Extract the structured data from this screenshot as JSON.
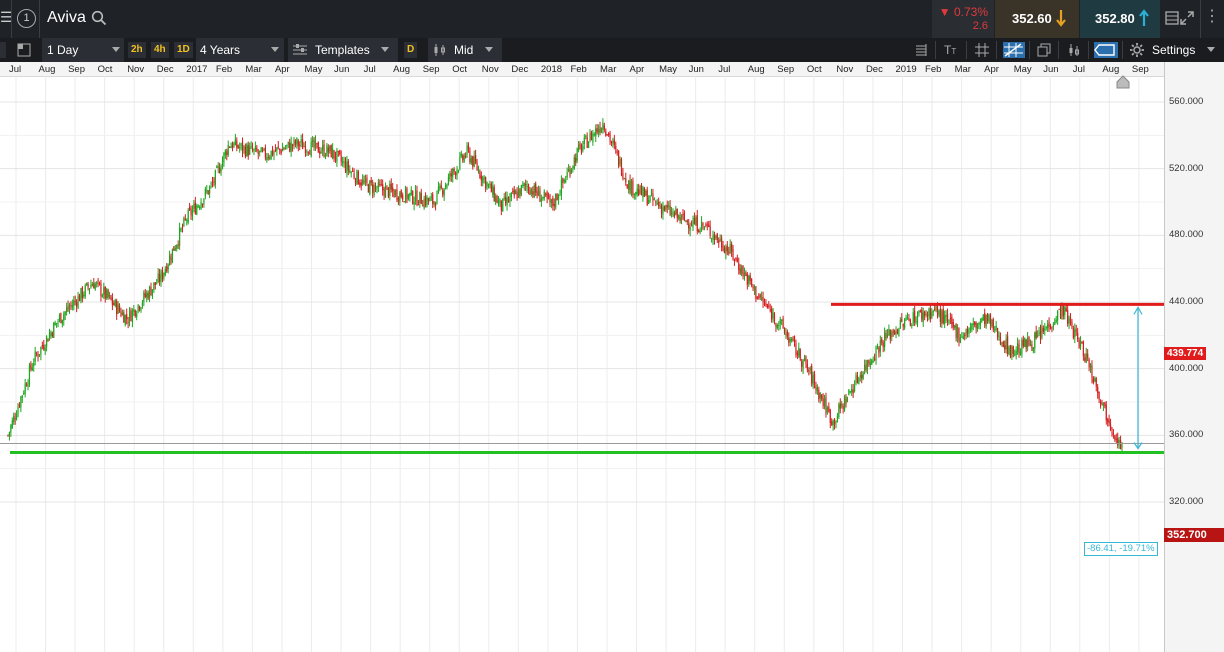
{
  "window": {
    "instrument": "Aviva",
    "info_label": "1"
  },
  "quote": {
    "change_pct": "▼ 0.73%",
    "change_abs": "2.6",
    "sell_price": "352.60",
    "buy_price": "352.80",
    "down_color": "#e03a3a",
    "up_color": "#29b0d8"
  },
  "toolbar": {
    "interval": "1 Day",
    "quick_2h": "2h",
    "quick_4h": "4h",
    "quick_1d": "1D",
    "range": "4 Years",
    "templates": "Templates",
    "d_badge": "D",
    "price_type": "Mid",
    "settings": "Settings",
    "icons": [
      "layout-icon",
      "text-size-icon",
      "grid-icon",
      "crosshair-icon",
      "copy-icon",
      "candle-type-icon",
      "price-tag-icon",
      "gear-icon"
    ]
  },
  "time_axis": [
    "Jul",
    "Aug",
    "Sep",
    "Oct",
    "Nov",
    "Dec",
    "2017",
    "Feb",
    "Mar",
    "Apr",
    "May",
    "Jun",
    "Jul",
    "Aug",
    "Sep",
    "Oct",
    "Nov",
    "Dec",
    "2018",
    "Feb",
    "Mar",
    "Apr",
    "May",
    "Jun",
    "Jul",
    "Aug",
    "Sep",
    "Oct",
    "Nov",
    "Dec",
    "2019",
    "Feb",
    "Mar",
    "Apr",
    "May",
    "Jun",
    "Jul",
    "Aug",
    "Sep"
  ],
  "price_axis": [
    "560.000",
    "520.000",
    "480.000",
    "440.000",
    "400.000",
    "360.000",
    "320.000"
  ],
  "resistance_tag": "439.774",
  "current_price_tag": "352.700",
  "measurement": "-86.41, -19.71%",
  "chart_data": {
    "type": "candlestick",
    "ylim": [
      310,
      575
    ],
    "support_level": 352.7,
    "resistance_level": 439.774,
    "measurement_delta": -86.41,
    "measurement_pct": -19.71,
    "anchors": [
      {
        "t": 0,
        "v": 360
      },
      {
        "t": 1.5,
        "v": 405
      },
      {
        "t": 3,
        "v": 430
      },
      {
        "t": 5,
        "v": 452
      },
      {
        "t": 7,
        "v": 430
      },
      {
        "t": 9,
        "v": 455
      },
      {
        "t": 10.5,
        "v": 490
      },
      {
        "t": 12,
        "v": 510
      },
      {
        "t": 13,
        "v": 535
      },
      {
        "t": 15,
        "v": 528
      },
      {
        "t": 17,
        "v": 535
      },
      {
        "t": 19,
        "v": 530
      },
      {
        "t": 21,
        "v": 510
      },
      {
        "t": 23,
        "v": 505
      },
      {
        "t": 25,
        "v": 500
      },
      {
        "t": 27,
        "v": 530
      },
      {
        "t": 29,
        "v": 497
      },
      {
        "t": 30.5,
        "v": 510
      },
      {
        "t": 32,
        "v": 498
      },
      {
        "t": 33.5,
        "v": 530
      },
      {
        "t": 35,
        "v": 548
      },
      {
        "t": 36.5,
        "v": 510
      },
      {
        "t": 38,
        "v": 500
      },
      {
        "t": 39.5,
        "v": 490
      },
      {
        "t": 41,
        "v": 485
      },
      {
        "t": 42.5,
        "v": 470
      },
      {
        "t": 44,
        "v": 445
      },
      {
        "t": 45.5,
        "v": 425
      },
      {
        "t": 47,
        "v": 400
      },
      {
        "t": 48.5,
        "v": 368
      },
      {
        "t": 50,
        "v": 395
      },
      {
        "t": 51.5,
        "v": 418
      },
      {
        "t": 53,
        "v": 430
      },
      {
        "t": 54.5,
        "v": 435
      },
      {
        "t": 56,
        "v": 420
      },
      {
        "t": 57.5,
        "v": 430
      },
      {
        "t": 59,
        "v": 410
      },
      {
        "t": 60.5,
        "v": 418
      },
      {
        "t": 62,
        "v": 436
      },
      {
        "t": 63.5,
        "v": 405
      },
      {
        "t": 64.5,
        "v": 375
      },
      {
        "t": 65.5,
        "v": 352
      }
    ]
  }
}
